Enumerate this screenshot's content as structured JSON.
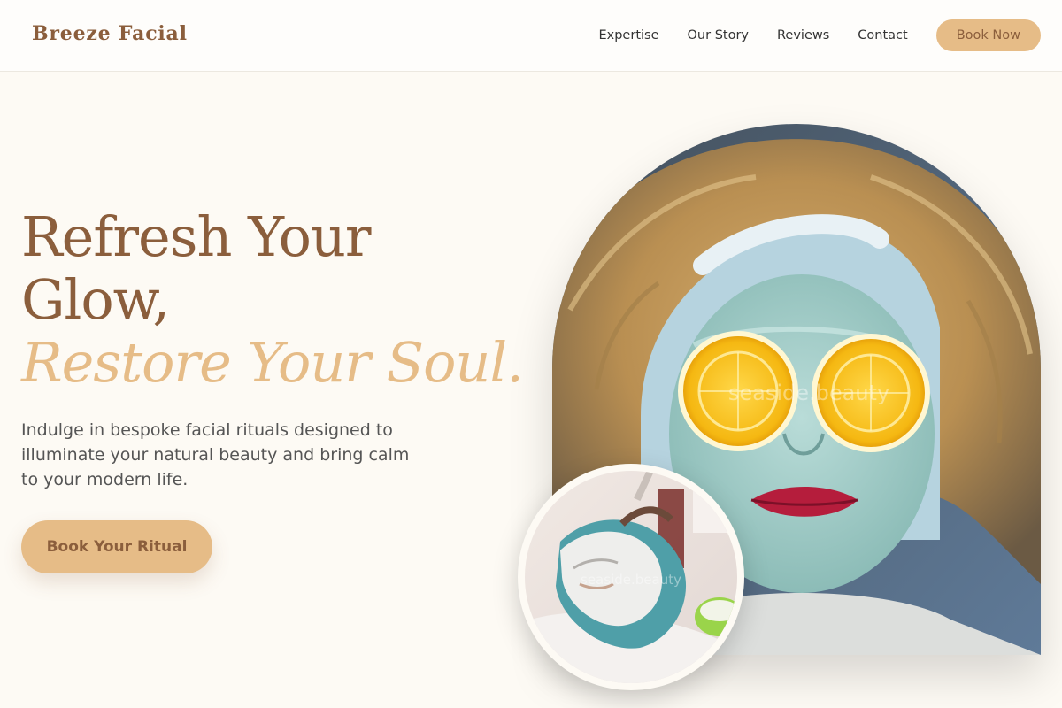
{
  "header": {
    "brand": "Breeze Facial",
    "nav": [
      {
        "label": "Expertise"
      },
      {
        "label": "Our Story"
      },
      {
        "label": "Reviews"
      },
      {
        "label": "Contact"
      }
    ],
    "cta_label": "Book Now"
  },
  "hero": {
    "title_line1": "Refresh Your",
    "title_line2": "Glow,",
    "title_accent": "Restore Your Soul.",
    "description": "Indulge in bespoke facial rituals designed to illuminate your natural beauty and bring calm to your modern life.",
    "cta_label": "Book Your Ritual"
  },
  "images": {
    "main_watermark": "seaside.beauty",
    "inset_watermark": "seaside.beauty"
  },
  "colors": {
    "brand_brown": "#8b5e3c",
    "accent_gold": "#e6bc87",
    "page_background": "#fdfaf4",
    "body_text": "#555555",
    "nav_text": "#333333"
  }
}
